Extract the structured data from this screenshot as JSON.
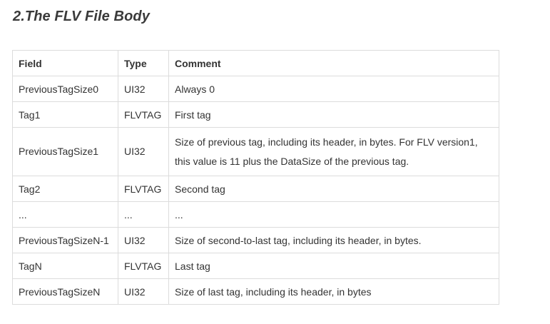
{
  "section": {
    "title": "2.The FLV File Body"
  },
  "table": {
    "headers": [
      "Field",
      "Type",
      "Comment"
    ],
    "rows": [
      [
        "PreviousTagSize0",
        "UI32",
        "Always 0"
      ],
      [
        "Tag1",
        "FLVTAG",
        "First tag"
      ],
      [
        "PreviousTagSize1",
        "UI32",
        "Size of previous tag, including its header, in bytes. For FLV version1, this value is 11 plus the DataSize of the previous tag."
      ],
      [
        "Tag2",
        "FLVTAG",
        "Second tag"
      ],
      [
        "...",
        "...",
        "..."
      ],
      [
        "PreviousTagSizeN-1",
        "UI32",
        "Size of second-to-last tag, including its header, in bytes."
      ],
      [
        "TagN",
        "FLVTAG",
        "Last tag"
      ],
      [
        "PreviousTagSizeN",
        "UI32",
        "Size of last tag, including its header, in bytes"
      ]
    ]
  }
}
